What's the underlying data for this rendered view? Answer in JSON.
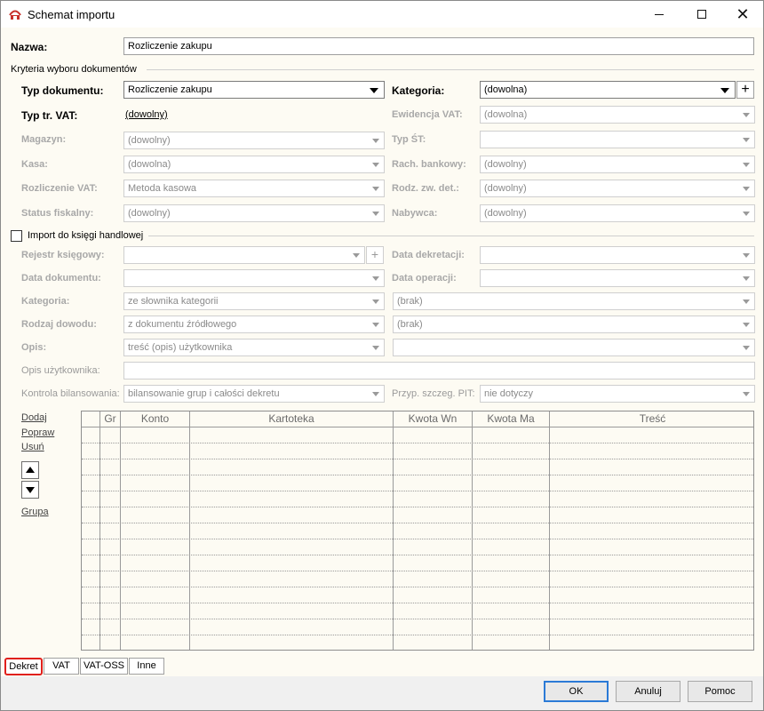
{
  "window": {
    "title": "Schemat importu"
  },
  "name_field": {
    "label": "Nazwa:",
    "value": "Rozliczenie zakupu"
  },
  "criteria": {
    "section_label": "Kryteria wyboru dokumentów",
    "typ_dokumentu": {
      "label": "Typ dokumentu:",
      "value": "Rozliczenie zakupu"
    },
    "kategoria": {
      "label": "Kategoria:",
      "value": "(dowolna)"
    },
    "typ_tr_vat": {
      "label": "Typ tr. VAT:",
      "value": "(dowolny)"
    },
    "ewidencja_vat": {
      "label": "Ewidencja VAT:",
      "value": "(dowolna)"
    },
    "magazyn": {
      "label": "Magazyn:",
      "value": "(dowolny)"
    },
    "typ_st": {
      "label": "Typ ŚT:",
      "value": ""
    },
    "kasa": {
      "label": "Kasa:",
      "value": "(dowolna)"
    },
    "rach_bankowy": {
      "label": "Rach. bankowy:",
      "value": "(dowolny)"
    },
    "rozliczenie_vat": {
      "label": "Rozliczenie VAT:",
      "value": "Metoda kasowa"
    },
    "rodz_zw_det": {
      "label": "Rodz. zw. det.:",
      "value": "(dowolny)"
    },
    "status_fiskalny": {
      "label": "Status fiskalny:",
      "value": "(dowolny)"
    },
    "nabywca": {
      "label": "Nabywca:",
      "value": "(dowolny)"
    }
  },
  "import": {
    "checkbox_label": "Import do księgi handlowej",
    "checked": false,
    "rejestr": {
      "label": "Rejestr księgowy:",
      "value": ""
    },
    "data_dekretacji": {
      "label": "Data dekretacji:",
      "value": ""
    },
    "data_dokumentu": {
      "label": "Data dokumentu:",
      "value": ""
    },
    "data_operacji": {
      "label": "Data operacji:",
      "value": ""
    },
    "kategoria": {
      "label": "Kategoria:",
      "value": "ze słownika kategorii",
      "value2": "(brak)"
    },
    "rodzaj_dowodu": {
      "label": "Rodzaj dowodu:",
      "value": "z dokumentu źródłowego",
      "value2": "(brak)"
    },
    "opis": {
      "label": "Opis:",
      "value": "treść (opis) użytkownika",
      "value2": ""
    },
    "opis_uzytkownika": {
      "label": "Opis użytkownika:",
      "value": ""
    },
    "kontrola": {
      "label": "Kontrola bilansowania:",
      "value": "bilansowanie grup i całości dekretu"
    },
    "przyp_pit": {
      "label": "Przyp. szczeg. PIT:",
      "value": "nie dotyczy"
    }
  },
  "side_actions": {
    "add": "Dodaj",
    "edit": "Popraw",
    "delete": "Usuń",
    "group": "Grupa"
  },
  "table": {
    "columns": [
      "Gr",
      "Konto",
      "Kartoteka",
      "Kwota Wn",
      "Kwota Ma",
      "Treść"
    ],
    "rows": []
  },
  "tabs": [
    {
      "label": "Dekret",
      "active": true
    },
    {
      "label": "VAT",
      "active": false
    },
    {
      "label": "VAT-OSS",
      "active": false
    },
    {
      "label": "Inne",
      "active": false
    }
  ],
  "buttons": {
    "ok": "OK",
    "cancel": "Anuluj",
    "help": "Pomoc"
  },
  "colors": {
    "form_bg": "#fdfbf3",
    "active_tab_outline": "#e0201c",
    "default_button_border": "#2b7ad6"
  }
}
